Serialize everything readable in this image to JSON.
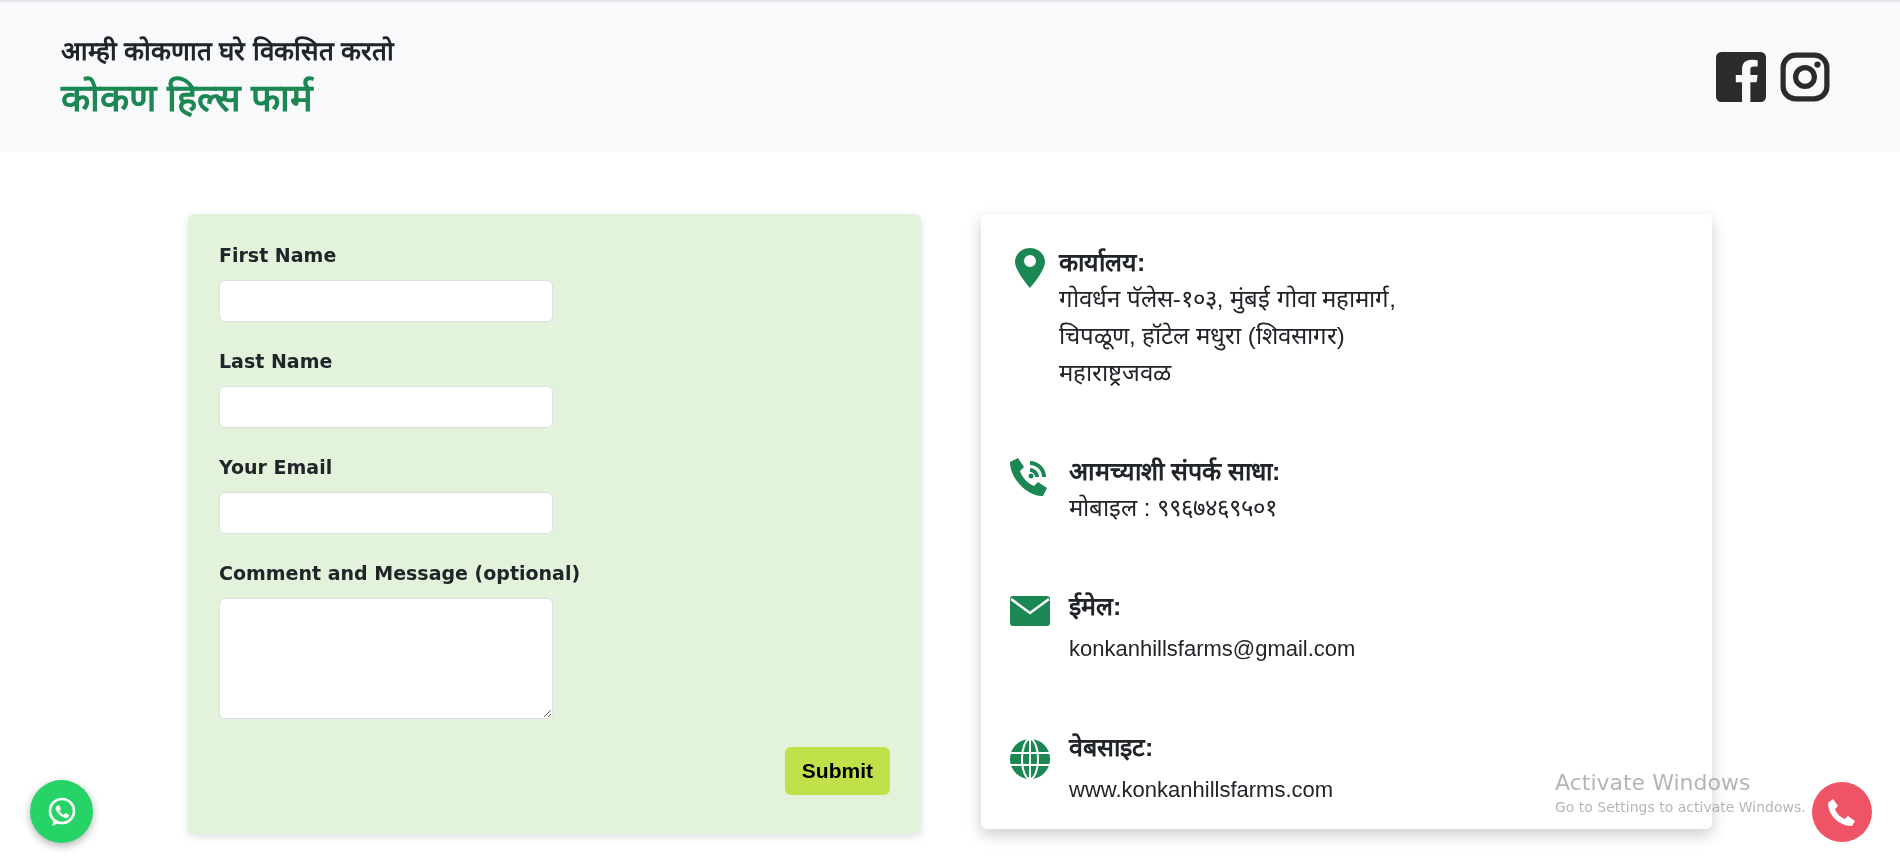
{
  "header": {
    "tagline": "आम्ही कोकणात घरे विकसित करतो",
    "title": "कोकण हिल्स फार्म"
  },
  "social": [
    {
      "kind": "facebook"
    },
    {
      "kind": "instagram"
    }
  ],
  "form": {
    "fields": [
      {
        "label": "First Name",
        "kind": "input"
      },
      {
        "label": "Last Name",
        "kind": "input"
      },
      {
        "label": "Your Email",
        "kind": "input"
      },
      {
        "label": "Comment and Message (optional)",
        "kind": "textarea"
      }
    ],
    "submit": "Submit"
  },
  "contact": [
    {
      "kind": "location",
      "heading": "कार्यालय:",
      "lines": [
        "गोवर्धन पॅलेस-१०३, मुंबई गोवा महामार्ग,",
        "चिपळूण, हॉटेल मधुरा (शिवसागर)",
        "महाराष्ट्रजवळ"
      ]
    },
    {
      "kind": "phone",
      "heading": "आमच्याशी संपर्क साधा:",
      "lines": [
        "मोबाइल : ९९६७४६९५०१"
      ]
    },
    {
      "kind": "email",
      "heading": "ईमेल:",
      "lines": [
        "konkanhillsfarms@gmail.com"
      ]
    },
    {
      "kind": "website",
      "heading": "वेबसाइट:",
      "lines": [
        "www.konkanhillsfarms.com"
      ]
    }
  ],
  "os_overlay": {
    "title": "Activate Windows",
    "subtitle": "Go to Settings to activate Windows."
  }
}
